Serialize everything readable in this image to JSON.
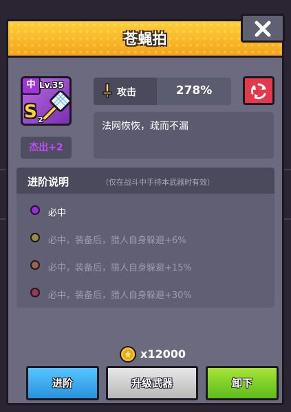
{
  "dialog": {
    "title": "苍蝇拍"
  },
  "weapon": {
    "tier_badge": "中",
    "level": "Lv.35",
    "grade": "S",
    "grade_stars": "2",
    "quality": "杰出+2"
  },
  "stat": {
    "label": "攻击",
    "value": "278%"
  },
  "description": "法网恢恢，疏而不漏",
  "advance": {
    "title": "进阶说明",
    "note": "（仅在战斗中手持本武器时有效）",
    "items": [
      {
        "text": "必中",
        "dot_color": "#a02ad8",
        "text_color": "#ffffff"
      },
      {
        "text": "必中，装备后，猎人自身躲避+6%",
        "dot_color": "#9c8a44",
        "text_color": "#9d9cae"
      },
      {
        "text": "必中，装备后，猎人自身躲避+15%",
        "dot_color": "#9a6444",
        "text_color": "#9d9cae"
      },
      {
        "text": "必中，装备后，猎人自身躲避+30%",
        "dot_color": "#983a56",
        "text_color": "#9d9cae"
      }
    ]
  },
  "cost": {
    "amount": "x12000"
  },
  "buttons": {
    "advance": "进阶",
    "upgrade": "升级武器",
    "unequip": "卸下"
  },
  "colors": {
    "header": "#f3a51a",
    "panel": "#6b6a7e",
    "quality_text": "#c14dff",
    "advance_button": "#2a91dc",
    "unequip_button": "#5fbb1c"
  }
}
